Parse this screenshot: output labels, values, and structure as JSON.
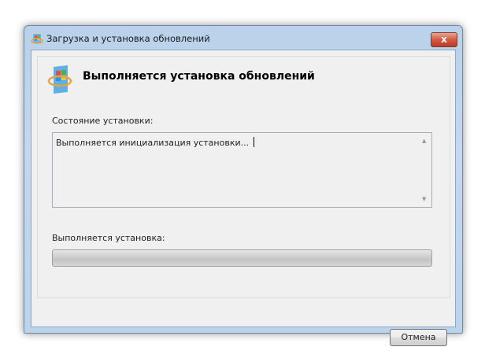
{
  "window": {
    "title": "Загрузка и установка обновлений",
    "close_label": "x"
  },
  "heading": "Выполняется установка обновлений",
  "status": {
    "label": "Состояние установки:",
    "text": "Выполняется инициализация установки..."
  },
  "progress": {
    "label": "Выполняется установка:",
    "value_percent": 0
  },
  "buttons": {
    "cancel": "Отмена"
  },
  "scroll": {
    "up": "▲",
    "down": "▼"
  }
}
